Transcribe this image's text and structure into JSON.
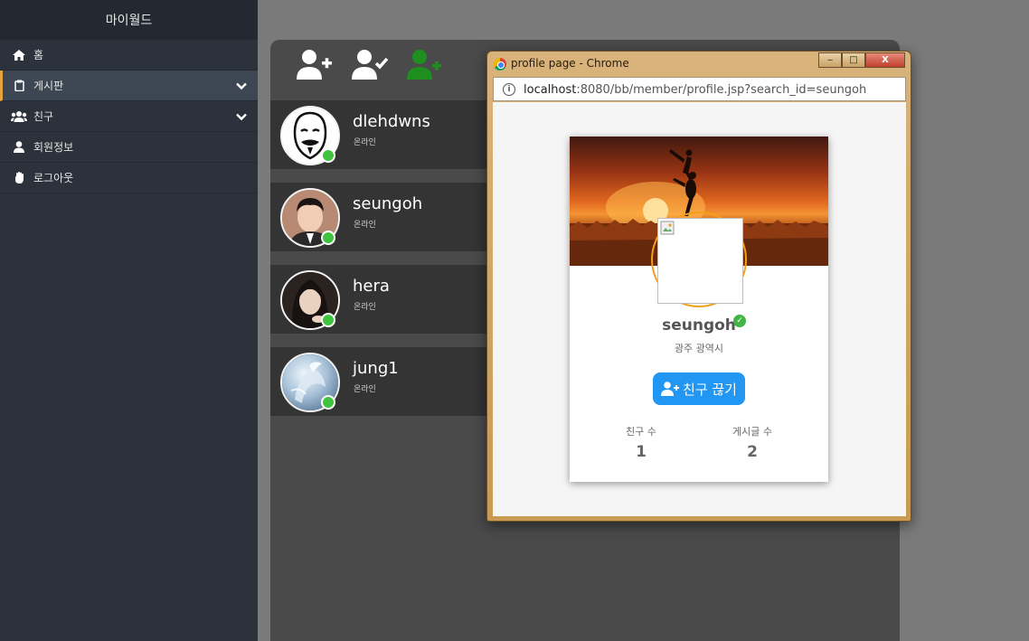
{
  "sidebar": {
    "title": "마이월드",
    "items": [
      {
        "label": "홈",
        "icon": "home-icon"
      },
      {
        "label": "게시판",
        "icon": "clipboard-icon",
        "active": true,
        "expandable": true
      },
      {
        "label": "친구",
        "icon": "users-icon",
        "expandable": true
      },
      {
        "label": "회원정보",
        "icon": "user-icon"
      },
      {
        "label": "로그아웃",
        "icon": "hand-icon"
      }
    ]
  },
  "toolbar": {
    "icons": [
      "user-plus-icon",
      "user-check-icon",
      "user-friends-icon"
    ],
    "active_color": "#1e8e1e"
  },
  "friends": [
    {
      "name": "dlehdwns",
      "status": "온라인"
    },
    {
      "name": "seungoh",
      "status": "온라인"
    },
    {
      "name": "hera",
      "status": "온라인"
    },
    {
      "name": "jung1",
      "status": "온라인"
    }
  ],
  "popup": {
    "window_title": "profile page - Chrome",
    "url_host": "localhost",
    "url_rest": ":8080/bb/member/profile.jsp?search_id=seungoh",
    "window_controls": {
      "minimize": "‒",
      "maximize": "□",
      "close": "X"
    }
  },
  "profile": {
    "name": "seungoh",
    "location": "광주 광역시",
    "unfriend_label": "친구 끊기",
    "stats": [
      {
        "label": "친구 수",
        "value": "1"
      },
      {
        "label": "게시글 수",
        "value": "2"
      }
    ]
  },
  "colors": {
    "sidebar_bg": "#2b323b",
    "active_accent": "#e5a23d",
    "online": "#3ec43e",
    "primary_button": "#2196f3",
    "verified": "#43b446"
  }
}
